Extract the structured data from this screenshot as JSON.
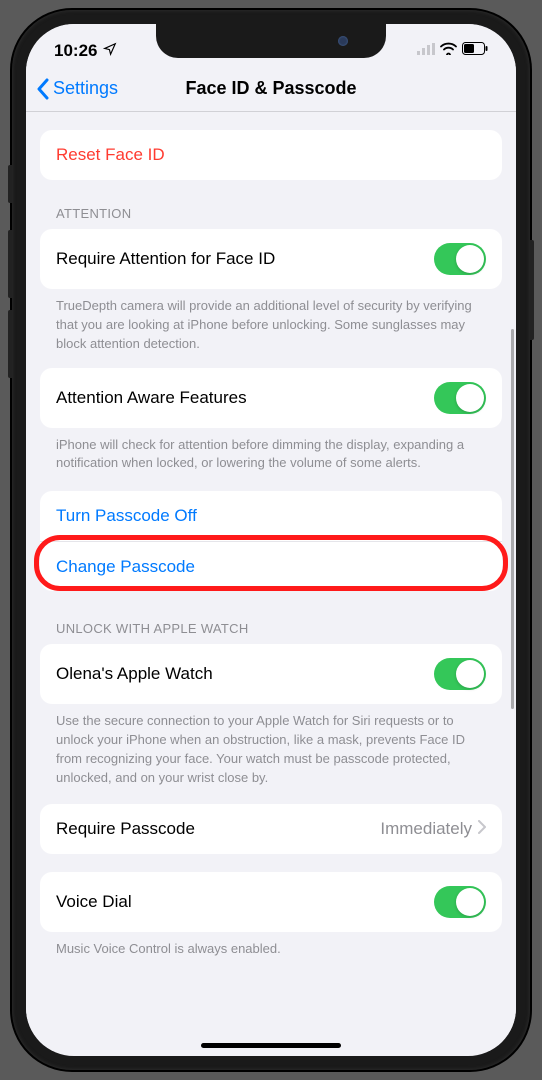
{
  "status": {
    "time": "10:26",
    "location_icon": "location-arrow-icon",
    "signal_icon": "cell-signal-icon",
    "wifi_icon": "wifi-icon",
    "battery_icon": "battery-icon"
  },
  "nav": {
    "back_label": "Settings",
    "title": "Face ID & Passcode"
  },
  "reset": {
    "label": "Reset Face ID"
  },
  "attention": {
    "header": "ATTENTION",
    "require_label": "Require Attention for Face ID",
    "require_on": true,
    "require_footer": "TrueDepth camera will provide an additional level of security by verifying that you are looking at iPhone before unlocking. Some sunglasses may block attention detection.",
    "aware_label": "Attention Aware Features",
    "aware_on": true,
    "aware_footer": "iPhone will check for attention before dimming the display, expanding a notification when locked, or lowering the volume of some alerts."
  },
  "passcode": {
    "turn_off_label": "Turn Passcode Off",
    "change_label": "Change Passcode"
  },
  "watch": {
    "header": "UNLOCK WITH APPLE WATCH",
    "device_label": "Olena's Apple Watch",
    "device_on": true,
    "footer": "Use the secure connection to your Apple Watch for Siri requests or to unlock your iPhone when an obstruction, like a mask, prevents Face ID from recognizing your face. Your watch must be passcode protected, unlocked, and on your wrist close by."
  },
  "require_passcode": {
    "label": "Require Passcode",
    "value": "Immediately"
  },
  "voice_dial": {
    "label": "Voice Dial",
    "on": true,
    "footer": "Music Voice Control is always enabled."
  }
}
